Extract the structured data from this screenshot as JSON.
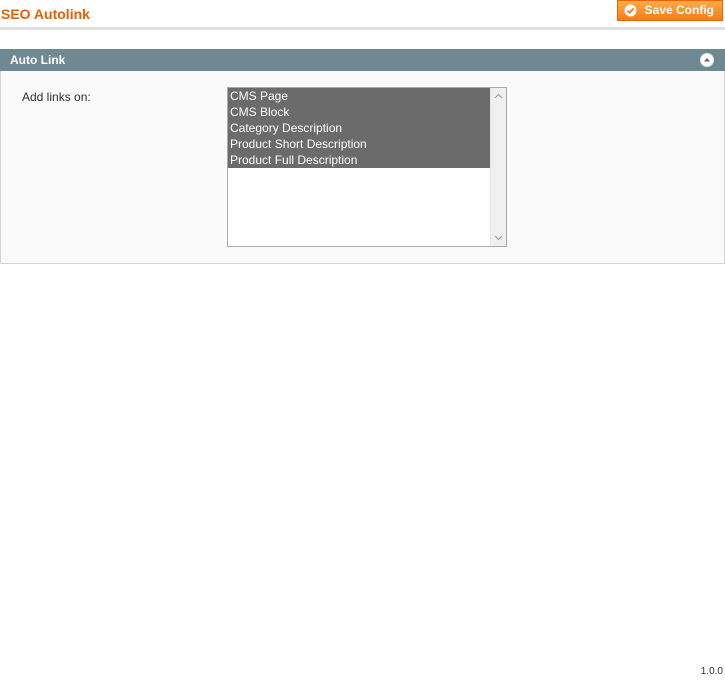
{
  "header": {
    "title": "SEO Autolink",
    "save_label": "Save Config"
  },
  "section": {
    "title": "Auto Link",
    "field_label": "Add links on:",
    "options": [
      {
        "label": "CMS Page",
        "selected": true
      },
      {
        "label": "CMS Block",
        "selected": true
      },
      {
        "label": "Category Description",
        "selected": true
      },
      {
        "label": "Product Short Description",
        "selected": true
      },
      {
        "label": "Product Full Description",
        "selected": true
      }
    ]
  },
  "footer": {
    "version": "1.0.0"
  },
  "colors": {
    "accent": "#eb5e00",
    "button": "#f77c16",
    "section_header": "#6f8992",
    "selected_option": "#6b6b6b"
  },
  "icons": {
    "save": "check-circle-icon",
    "collapse": "chevron-up-circle-icon"
  }
}
